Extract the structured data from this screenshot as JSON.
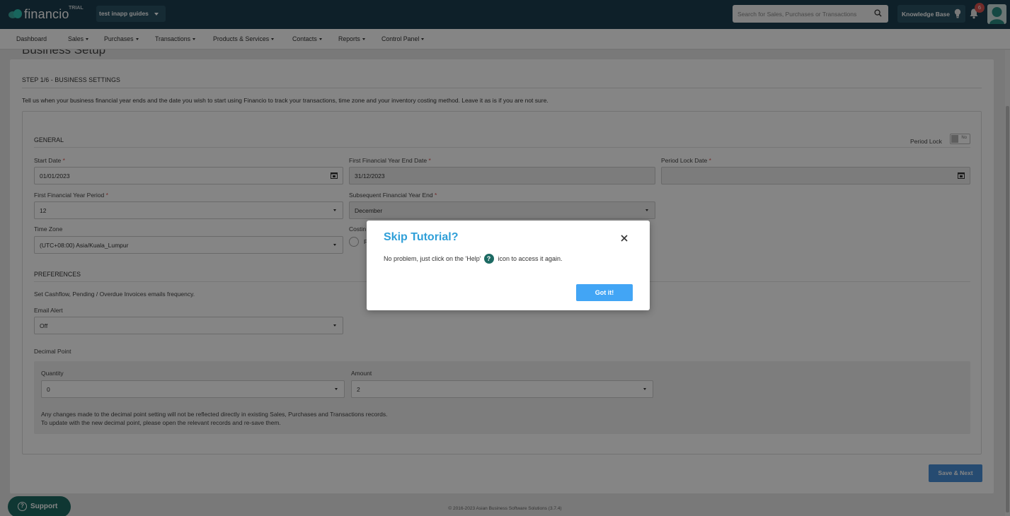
{
  "app": {
    "logo_text": "financio",
    "trial_label": "TRIAL",
    "company": "test inapp guides"
  },
  "header": {
    "search_placeholder": "Search for Sales, Purchases or Transactions",
    "knowledge_base": "Knowledge Base",
    "notification_count": "6"
  },
  "nav": [
    "Dashboard",
    "Sales",
    "Purchases",
    "Transactions",
    "Products & Services",
    "Contacts",
    "Reports",
    "Control Panel"
  ],
  "page": {
    "title": "Business Setup",
    "step": "STEP 1/6 - BUSINESS SETTINGS",
    "intro": "Tell us when your business financial year ends and the date you wish to start using Financio to track your transactions, time zone and your inventory costing method. Leave it as is if you are not sure."
  },
  "general": {
    "title": "GENERAL",
    "period_lock_label": "Period Lock",
    "period_lock_value": "No",
    "start_date_label": "Start Date",
    "start_date": "01/01/2023",
    "fy_end_label": "First Financial Year End Date",
    "fy_end": "31/12/2023",
    "period_lock_date_label": "Period Lock Date",
    "period_lock_date": "",
    "fy_period_label": "First Financial Year Period",
    "fy_period": "12",
    "subsequent_fy_label": "Subsequent Financial Year End",
    "subsequent_fy": "December",
    "timezone_label": "Time Zone",
    "timezone": "(UTC+08:00) Asia/Kuala_Lumpur",
    "costing_label": "Costin",
    "costing_option": "F"
  },
  "preferences": {
    "title": "PREFERENCES",
    "description": "Set Cashflow, Pending / Overdue Invoices emails frequency.",
    "email_alert_label": "Email Alert",
    "email_alert": "Off"
  },
  "decimal": {
    "title": "Decimal Point",
    "quantity_label": "Quantity",
    "quantity": "0",
    "amount_label": "Amount",
    "amount": "2",
    "note_line1": "Any changes made to the decimal point setting will not be reflected directly in existing Sales, Purchases and Transactions records.",
    "note_line2": "To update with the new decimal point, please open the relevant records and re-save them."
  },
  "actions": {
    "save_next": "Save & Next"
  },
  "footer": "© 2016-2023 Asian Business Software Solutions (3.7.4)",
  "support": "Support",
  "modal": {
    "title": "Skip Tutorial?",
    "text_before": "No problem, just click on the 'Help'",
    "text_after": "icon to access it again.",
    "help_glyph": "?",
    "button": "Got it!"
  },
  "colors": {
    "header_bg": "#1c3f4f",
    "accent": "#2f9fd8",
    "button": "#42a5f5",
    "support_bg": "#1d6a63"
  }
}
